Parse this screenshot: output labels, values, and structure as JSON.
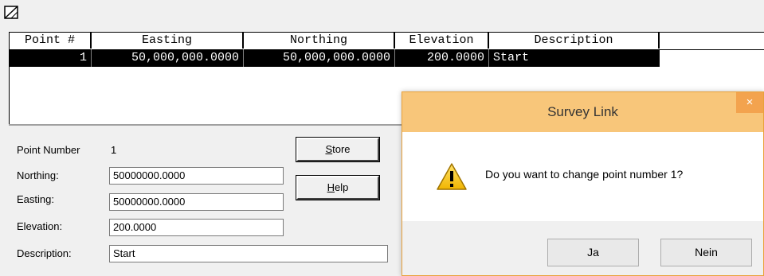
{
  "grid": {
    "columns": [
      "Point #",
      "Easting",
      "Northing",
      "Elevation",
      "Description"
    ],
    "rows": [
      {
        "point": "1",
        "easting": "50,000,000.0000",
        "northing": "50,000,000.0000",
        "elevation": "200.0000",
        "description": "Start"
      }
    ]
  },
  "form": {
    "point_number_label": "Point Number",
    "point_number_value": "1",
    "northing_label": "Northing:",
    "northing_value": "50000000.0000",
    "easting_label": "Easting:",
    "easting_value": "50000000.0000",
    "elevation_label": "Elevation:",
    "elevation_value": "200.0000",
    "description_label": "Description:",
    "description_value": "Start",
    "store_first": "S",
    "store_rest": "tore",
    "help_first": "H",
    "help_rest": "elp"
  },
  "dialog": {
    "title": "Survey Link",
    "close": "×",
    "message": "Do you want to change point number 1?",
    "yes": "Ja",
    "no": "Nein"
  },
  "colors": {
    "dialog_title_bg": "#f8c67a",
    "dialog_close_bg": "#f3a34e",
    "selected_row_bg": "#000000"
  },
  "icons": [
    "app-icon",
    "warning-icon"
  ]
}
